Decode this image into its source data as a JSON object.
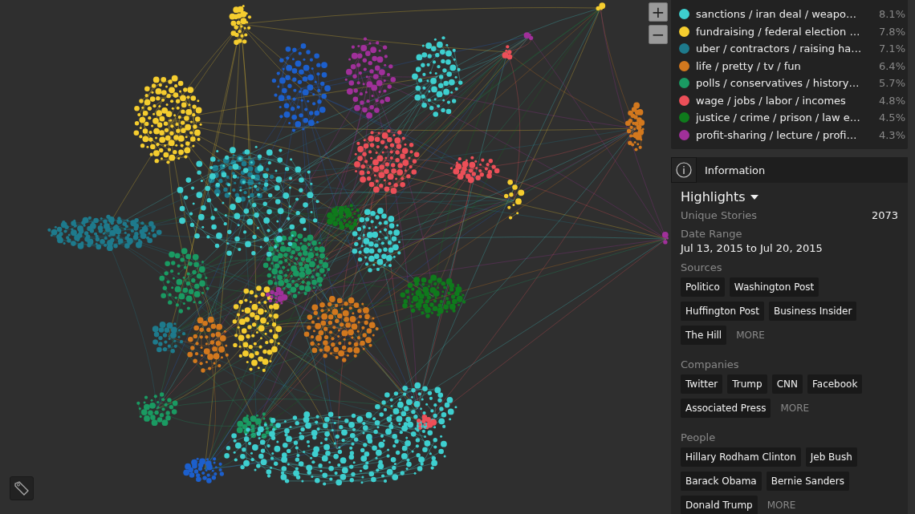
{
  "topics": [
    {
      "label": "sanctions / iran deal / weapo…",
      "share": "8.1%",
      "color": "#3ecfcf"
    },
    {
      "label": "fundraising / federal election …",
      "share": "7.8%",
      "color": "#f5cd2f"
    },
    {
      "label": "uber / contractors / raising ha…",
      "share": "7.1%",
      "color": "#1e7a8c"
    },
    {
      "label": "life / pretty / tv / fun",
      "share": "6.4%",
      "color": "#d2781e"
    },
    {
      "label": "polls / conservatives / history…",
      "share": "5.7%",
      "color": "#1a9a62"
    },
    {
      "label": "wage / jobs / labor / incomes",
      "share": "4.8%",
      "color": "#ec4f58"
    },
    {
      "label": "justice / crime / prison / law e…",
      "share": "4.5%",
      "color": "#0f7a1c"
    },
    {
      "label": "profit-sharing / lecture / profi…",
      "share": "4.3%",
      "color": "#a0309a"
    }
  ],
  "zoom_buttons": [
    "+",
    "−"
  ],
  "info": {
    "title": "Information",
    "highlights": "Highlights",
    "stats": [
      {
        "label": "Unique Stories",
        "value": "2073"
      }
    ],
    "date_range": {
      "label": "Date Range",
      "value": "Jul 13, 2015 to Jul 20, 2015"
    },
    "groups": [
      {
        "label": "Sources",
        "tags": [
          "Politico",
          "Washington Post",
          "Huffington Post",
          "Business Insider",
          "The Hill"
        ],
        "more": "MORE"
      },
      {
        "label": "Companies",
        "tags": [
          "Twitter",
          "Trump",
          "CNN",
          "Facebook",
          "Associated Press"
        ],
        "more": "MORE"
      },
      {
        "label": "People",
        "tags": [
          "Hillary Rodham Clinton",
          "Jeb Bush",
          "Barack Obama",
          "Bernie Sanders",
          "Donald Trump"
        ],
        "more": "MORE"
      }
    ]
  }
}
